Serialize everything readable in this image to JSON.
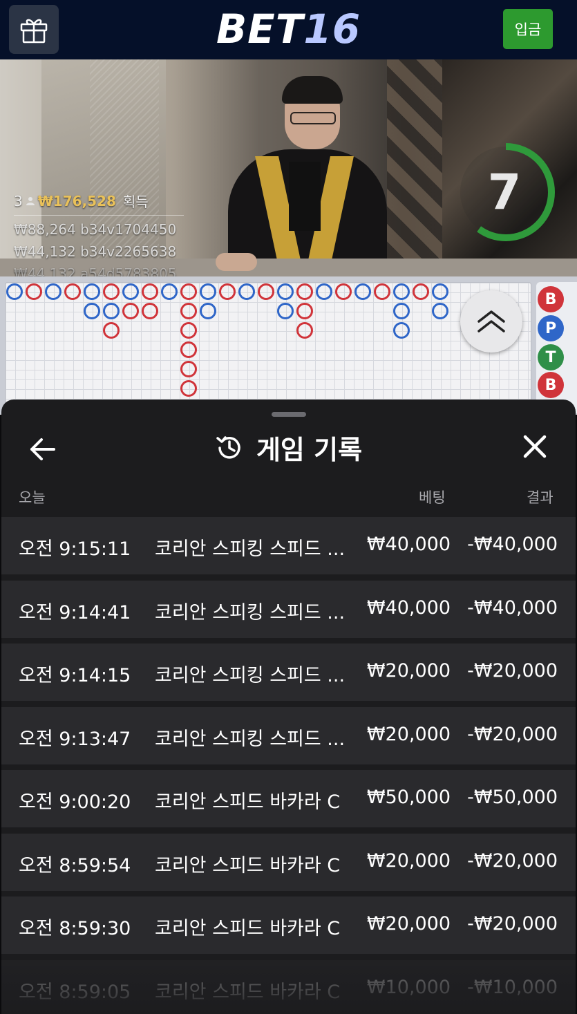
{
  "header": {
    "logo_main": "BET",
    "logo_num": "16",
    "deposit_label": "입금"
  },
  "video": {
    "timer_value": "7",
    "timer_fraction": 0.6,
    "winners": {
      "count": "3",
      "amount": "₩176,528",
      "label": "획득",
      "entries": [
        "₩88,264  b34v1704450",
        "₩44,132  b34v2265638",
        "₩44,132  a54d5783805"
      ]
    }
  },
  "roadmap": {
    "colors": {
      "banker": "#d0343a",
      "player": "#2f66c8",
      "tie": "#2f8f48"
    },
    "columns": [
      [
        "P"
      ],
      [
        "B"
      ],
      [
        "P"
      ],
      [
        "B"
      ],
      [
        "P",
        "P"
      ],
      [
        "B",
        "P",
        "B"
      ],
      [
        "P",
        "B"
      ],
      [
        "B",
        "B"
      ],
      [
        "P"
      ],
      [
        "B",
        "B",
        "B",
        "B",
        "B",
        "B"
      ],
      [
        "P",
        "P"
      ],
      [
        "B"
      ],
      [
        "P"
      ],
      [
        "B"
      ],
      [
        "P",
        "P"
      ],
      [
        "B",
        "B",
        "B"
      ],
      [
        "P"
      ],
      [
        "B"
      ],
      [
        "P"
      ],
      [
        "B"
      ],
      [
        "P",
        "P",
        "P"
      ],
      [
        "B"
      ],
      [
        "P",
        "P"
      ]
    ],
    "predictions": [
      "B",
      "P",
      "T",
      "B"
    ]
  },
  "sheet": {
    "title": "게임 기록",
    "col_today": "오늘",
    "col_bet": "베팅",
    "col_result": "결과",
    "rows": [
      {
        "time": "오전 9:15:11",
        "game": "코리안 스피킹 스피드 ...",
        "bet": "₩40,000",
        "result": "-₩40,000"
      },
      {
        "time": "오전 9:14:41",
        "game": "코리안 스피킹 스피드 ...",
        "bet": "₩40,000",
        "result": "-₩40,000"
      },
      {
        "time": "오전 9:14:15",
        "game": "코리안 스피킹 스피드 ...",
        "bet": "₩20,000",
        "result": "-₩20,000"
      },
      {
        "time": "오전 9:13:47",
        "game": "코리안 스피킹 스피드 ...",
        "bet": "₩20,000",
        "result": "-₩20,000"
      },
      {
        "time": "오전 9:00:20",
        "game": "코리안 스피드 바카라 C",
        "bet": "₩50,000",
        "result": "-₩50,000"
      },
      {
        "time": "오전 8:59:54",
        "game": "코리안 스피드 바카라 C",
        "bet": "₩20,000",
        "result": "-₩20,000"
      },
      {
        "time": "오전 8:59:30",
        "game": "코리안 스피드 바카라 C",
        "bet": "₩20,000",
        "result": "-₩20,000"
      },
      {
        "time": "오전 8:59:05",
        "game": "코리안 스피드 바카라 C",
        "bet": "₩10,000",
        "result": "-₩10,000"
      }
    ]
  },
  "icons": {
    "gift": "gift-icon",
    "back": "arrow-left-icon",
    "history": "history-icon",
    "close": "close-icon",
    "expand": "chevron-double-up-icon",
    "user": "user-icon"
  }
}
